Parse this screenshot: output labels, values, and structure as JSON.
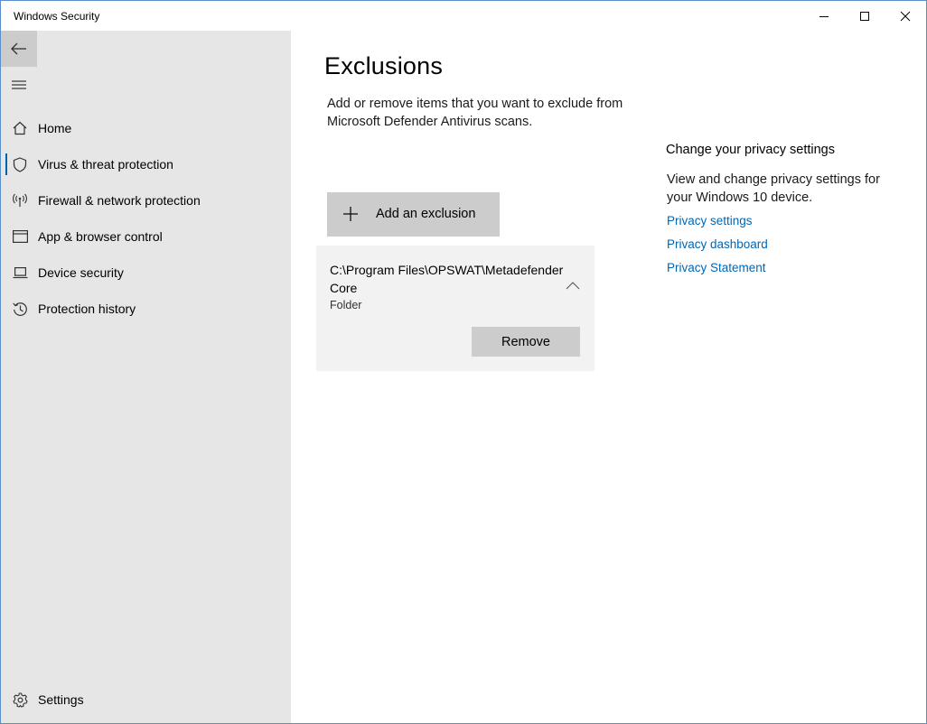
{
  "window": {
    "title": "Windows Security"
  },
  "sidebar": {
    "items": [
      {
        "label": "Home",
        "icon": "home-icon"
      },
      {
        "label": "Virus & threat protection",
        "icon": "shield-icon",
        "active": true
      },
      {
        "label": "Firewall & network protection",
        "icon": "wireless-icon"
      },
      {
        "label": "App & browser control",
        "icon": "browser-window-icon"
      },
      {
        "label": "Device security",
        "icon": "laptop-icon"
      },
      {
        "label": "Protection history",
        "icon": "history-icon"
      }
    ],
    "settings_label": "Settings"
  },
  "main": {
    "title": "Exclusions",
    "description": "Add or remove items that you want to exclude from Microsoft Defender Antivirus scans.",
    "add_button_label": "Add an exclusion",
    "exclusion": {
      "path": "C:\\Program Files\\OPSWAT\\Metadefender Core",
      "type": "Folder",
      "expanded": true,
      "remove_label": "Remove"
    }
  },
  "privacy": {
    "heading": "Change your privacy settings",
    "description": "View and change privacy settings for your Windows 10 device.",
    "links": [
      "Privacy settings",
      "Privacy dashboard",
      "Privacy Statement"
    ]
  },
  "colors": {
    "accent": "#0063b1",
    "link": "#0066b4",
    "sidebar_bg": "#e6e6e6",
    "button_bg": "#cccccc",
    "card_bg": "#f2f2f2"
  }
}
